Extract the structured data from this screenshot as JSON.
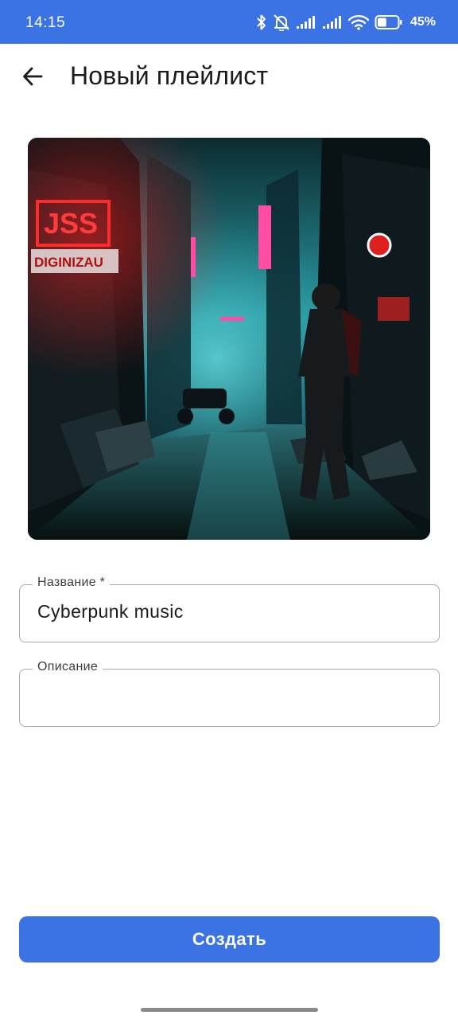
{
  "status_bar": {
    "time": "14:15",
    "battery_percent": "45%",
    "battery_level": 0.45,
    "icons": [
      "bluetooth-icon",
      "bell-off-icon",
      "signal-icon",
      "signal-icon",
      "wifi-icon",
      "battery-icon"
    ]
  },
  "app_bar": {
    "title": "Новый плейлист",
    "back_icon": "arrow-left-icon"
  },
  "form": {
    "name_label": "Название *",
    "name_value": "Cyberpunk music",
    "description_label": "Описание",
    "description_value": ""
  },
  "cover_sign_text": "DIGINIZAU",
  "actions": {
    "create_label": "Создать"
  },
  "colors": {
    "accent": "#3b72e4",
    "field_border": "#a9a9ad",
    "text": "#1b1b1f"
  }
}
